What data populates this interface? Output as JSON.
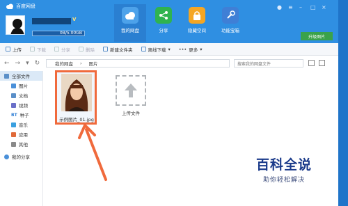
{
  "app": {
    "title": "百度网盘"
  },
  "user": {
    "quota": "0B/5.00GB"
  },
  "nav": [
    {
      "label": "我的网盘",
      "icon": "cloud-icon",
      "color": "#ffffff"
    },
    {
      "label": "分享",
      "icon": "share-icon",
      "color": "#2fb34f"
    },
    {
      "label": "隐藏空间",
      "icon": "lock-icon",
      "color": "#f5a623"
    },
    {
      "label": "功能宝箱",
      "icon": "wrench-icon",
      "color": "#3f7fd6"
    }
  ],
  "upgrade": {
    "label": "升级图片"
  },
  "toolbar": {
    "upload": "上传",
    "download": "下载",
    "share": "分享",
    "delete": "删除",
    "new_folder": "新建文件夹",
    "offline": "离线下载",
    "more": "更多"
  },
  "address": {
    "root": "我的网盘",
    "current": "图片",
    "search_placeholder": "搜索我的网盘文件"
  },
  "sidebar": {
    "all": "全部文件",
    "items": [
      {
        "label": "图片",
        "color": "#4a90d9"
      },
      {
        "label": "文档",
        "color": "#5a8fc8"
      },
      {
        "label": "视频",
        "color": "#6a6fc8"
      },
      {
        "label": "种子",
        "color": "#2f7fd6"
      },
      {
        "label": "音乐",
        "color": "#3aa0e0"
      },
      {
        "label": "应用",
        "color": "#e06a3a"
      },
      {
        "label": "其他",
        "color": "#8a8a8a"
      }
    ],
    "bt": "BT",
    "my_share": "我的分享"
  },
  "files": [
    {
      "name": "示例图片_01.jpg"
    },
    {
      "name": "上传文件"
    }
  ],
  "watermark": {
    "title": "百科全说",
    "subtitle": "助你轻松解决"
  }
}
